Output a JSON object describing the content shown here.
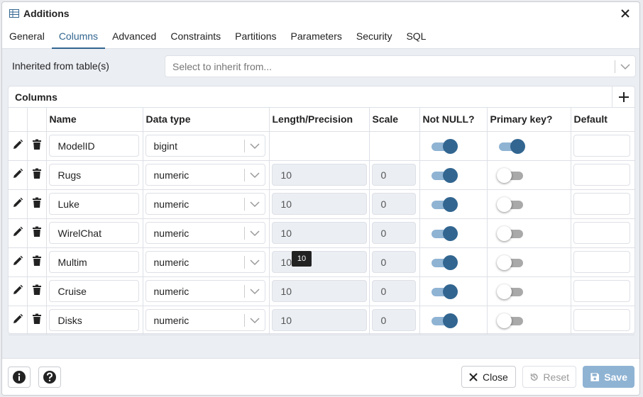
{
  "dialog": {
    "title": "Additions",
    "title_icon": "table-icon"
  },
  "tabs": [
    {
      "label": "General",
      "active": false
    },
    {
      "label": "Columns",
      "active": true
    },
    {
      "label": "Advanced",
      "active": false
    },
    {
      "label": "Constraints",
      "active": false
    },
    {
      "label": "Partitions",
      "active": false
    },
    {
      "label": "Parameters",
      "active": false
    },
    {
      "label": "Security",
      "active": false
    },
    {
      "label": "SQL",
      "active": false
    }
  ],
  "inherit": {
    "label": "Inherited from table(s)",
    "placeholder": "Select to inherit from..."
  },
  "columns_panel": {
    "title": "Columns",
    "headers": [
      "Name",
      "Data type",
      "Length/Precision",
      "Scale",
      "Not NULL?",
      "Primary key?",
      "Default"
    ],
    "rows": [
      {
        "name": "ModelID",
        "type": "bigint",
        "length": "",
        "scale": "",
        "not_null": true,
        "primary_key": true
      },
      {
        "name": "Rugs",
        "type": "numeric",
        "length": "10",
        "scale": "0",
        "not_null": true,
        "primary_key": false
      },
      {
        "name": "Luke",
        "type": "numeric",
        "length": "10",
        "scale": "0",
        "not_null": true,
        "primary_key": false
      },
      {
        "name": "WirelChat",
        "type": "numeric",
        "length": "10",
        "scale": "0",
        "not_null": true,
        "primary_key": false
      },
      {
        "name": "Multim",
        "type": "numeric",
        "length": "10",
        "scale": "0",
        "not_null": true,
        "primary_key": false
      },
      {
        "name": "Cruise",
        "type": "numeric",
        "length": "10",
        "scale": "0",
        "not_null": true,
        "primary_key": false
      },
      {
        "name": "Disks",
        "type": "numeric",
        "length": "10",
        "scale": "0",
        "not_null": true,
        "primary_key": false
      }
    ]
  },
  "tooltip": {
    "text": "10"
  },
  "footer": {
    "close_label": "Close",
    "reset_label": "Reset",
    "save_label": "Save"
  },
  "colors": {
    "accent": "#326690",
    "toggle_on_track": "#8fb3d3",
    "save_disabled": "#8fb3d3",
    "panel_bg": "#ebeef3"
  }
}
